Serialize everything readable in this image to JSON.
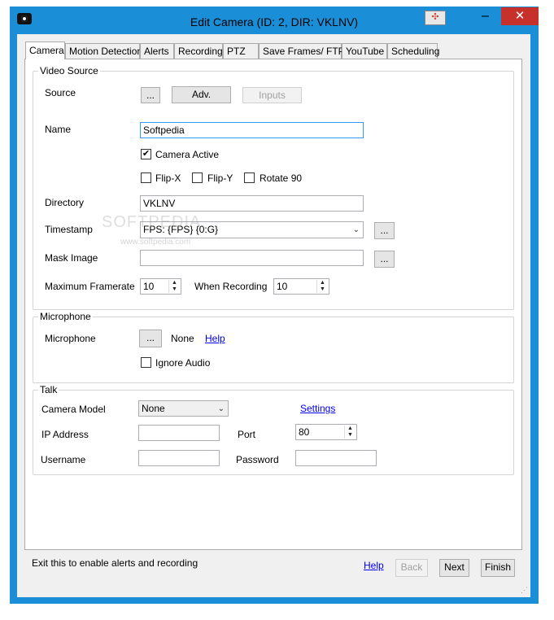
{
  "window": {
    "title": "Edit Camera (ID: 2, DIR: VKLNV)",
    "frame_color": "#1a8fd8",
    "close_color": "#c7312b"
  },
  "titlebar": {
    "minimize": "–",
    "maximize": "□",
    "close": "✕",
    "store_icon": "✣"
  },
  "tabs": [
    "Camera",
    "Motion Detection",
    "Alerts",
    "Recording",
    "PTZ",
    "Save Frames/ FTP",
    "YouTube",
    "Scheduling"
  ],
  "video_source": {
    "legend": "Video Source",
    "source_label": "Source",
    "source_browse": "...",
    "adv_button": "Adv.",
    "inputs_button": "Inputs",
    "name_label": "Name",
    "name_value": "Softpedia",
    "camera_active_label": "Camera Active",
    "camera_active_checked": "✔",
    "flip_x_label": "Flip-X",
    "flip_y_label": "Flip-Y",
    "rotate_label": "Rotate 90",
    "directory_label": "Directory",
    "directory_value": "VKLNV",
    "timestamp_label": "Timestamp",
    "timestamp_value": "FPS: {FPS} {0:G}",
    "timestamp_browse": "...",
    "mask_label": "Mask Image",
    "mask_value": "",
    "mask_browse": "...",
    "max_framerate_label": "Maximum Framerate",
    "max_framerate_value": "10",
    "when_recording_label": "When Recording",
    "when_recording_value": "10"
  },
  "microphone": {
    "legend": "Microphone",
    "label": "Microphone",
    "browse": "...",
    "value": "None",
    "help_link": "Help",
    "ignore_audio_label": "Ignore Audio"
  },
  "talk": {
    "legend": "Talk",
    "camera_model_label": "Camera Model",
    "camera_model_value": "None",
    "settings_link": "Settings",
    "ip_label": "IP Address",
    "ip_value": "",
    "port_label": "Port",
    "port_value": "80",
    "username_label": "Username",
    "username_value": "",
    "password_label": "Password",
    "password_value": ""
  },
  "footer": {
    "status_text": "Exit this to enable alerts and recording",
    "help_link": "Help",
    "back_button": "Back",
    "next_button": "Next",
    "finish_button": "Finish"
  },
  "watermark": {
    "text": "SOFTPEDIA",
    "url": "www.softpedia.com"
  },
  "icons": {
    "spin_up": "▲",
    "spin_down": "▼",
    "combo_arrow": "⌄",
    "grip": "⋰"
  }
}
